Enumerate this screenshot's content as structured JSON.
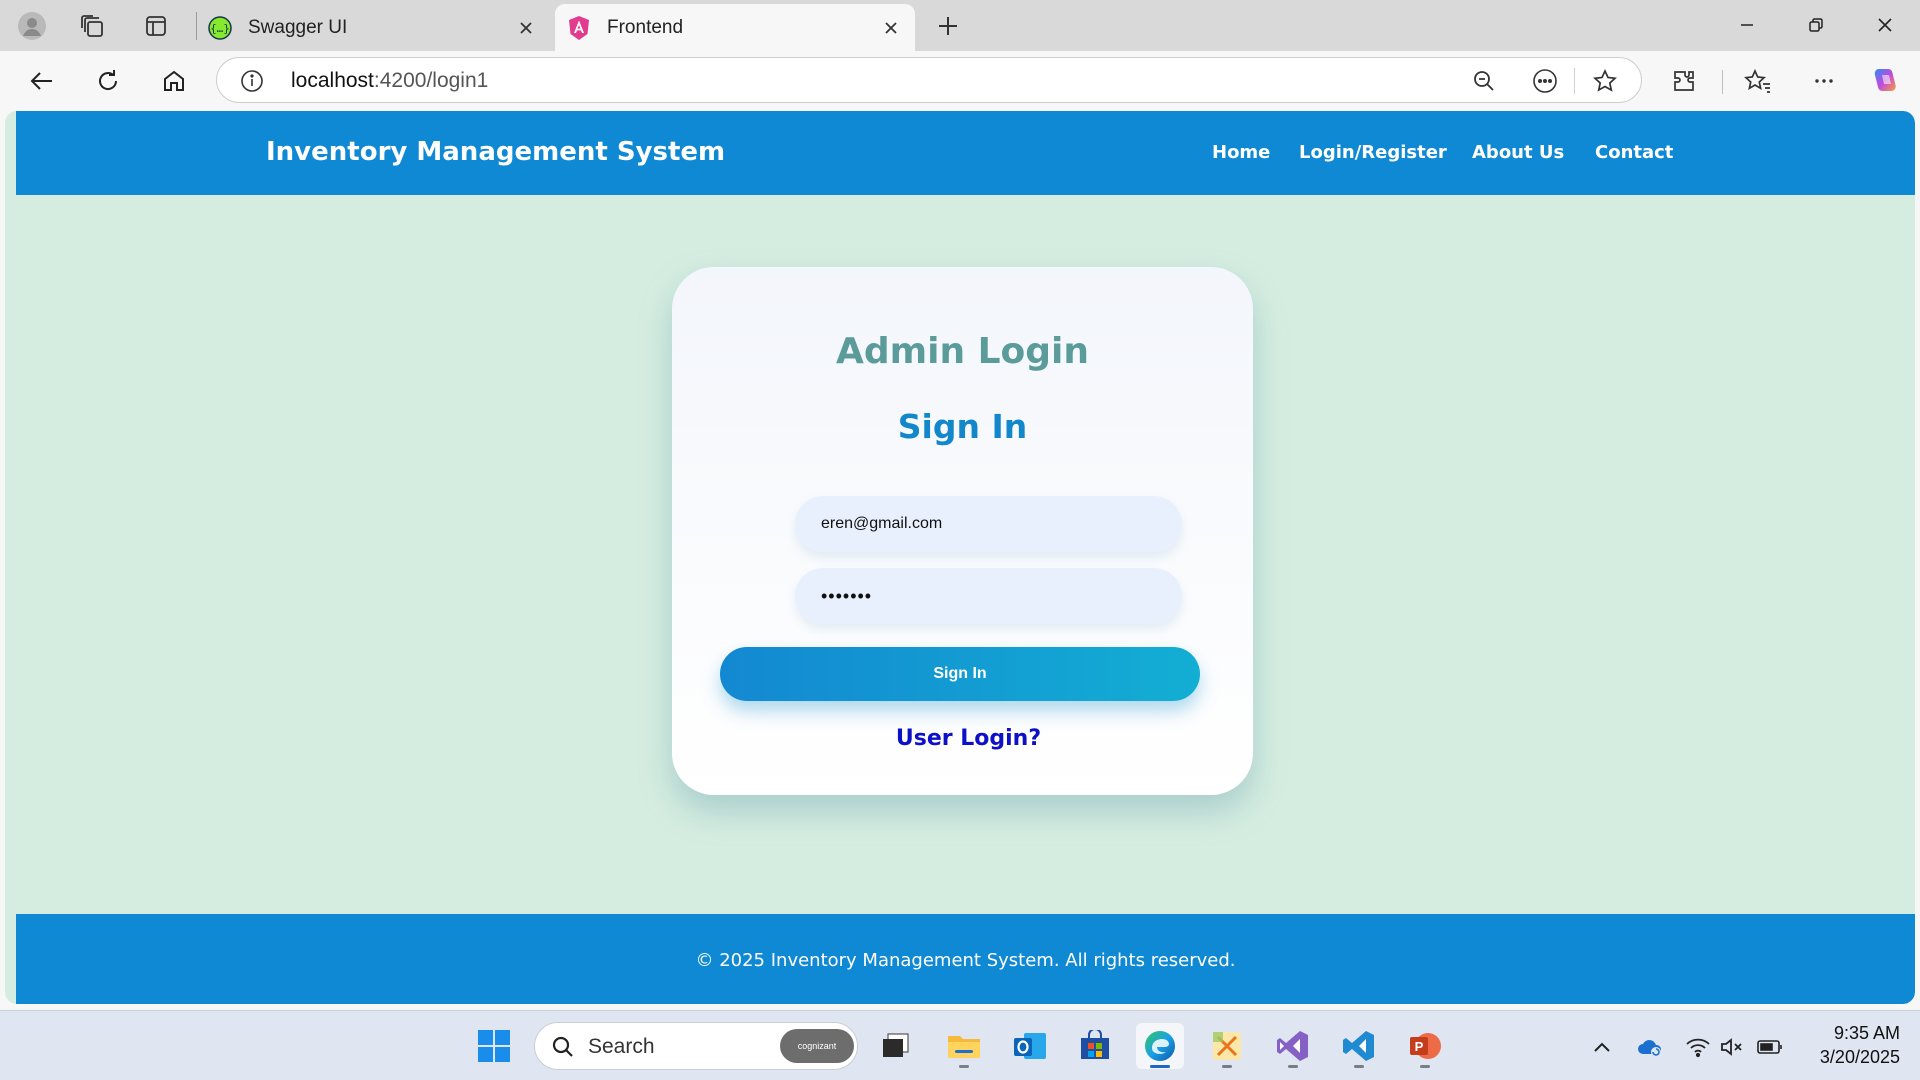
{
  "browser": {
    "tabs": [
      {
        "title": "Swagger UI",
        "icon": "swagger-icon"
      },
      {
        "title": "Frontend",
        "icon": "angular-icon",
        "active": true
      }
    ],
    "url_host": "localhost",
    "url_path": ":4200/login1"
  },
  "site": {
    "brand": "Inventory Management System",
    "nav": [
      "Home",
      "Login/Register",
      "About Us",
      "Contact"
    ],
    "header_color": "#0f89d3",
    "background_color": "#d5ede0"
  },
  "login": {
    "title": "Admin Login",
    "subtitle": "Sign In",
    "email_value": "eren@gmail.com",
    "password_value": "•••••••",
    "button_label": "Sign In",
    "user_link": "User Login?"
  },
  "footer": {
    "text": "© 2025 Inventory Management System. All rights reserved."
  },
  "taskbar": {
    "search_label": "Search",
    "search_badge": "cognizant",
    "time": "9:35 AM",
    "date": "3/20/2025",
    "apps": [
      "windows-start-icon",
      "file-explorer-icon",
      "outlook-icon",
      "microsoft-store-icon",
      "edge-icon",
      "snipping-tool-icon",
      "visual-studio-icon",
      "vscode-icon",
      "powerpoint-icon"
    ]
  }
}
